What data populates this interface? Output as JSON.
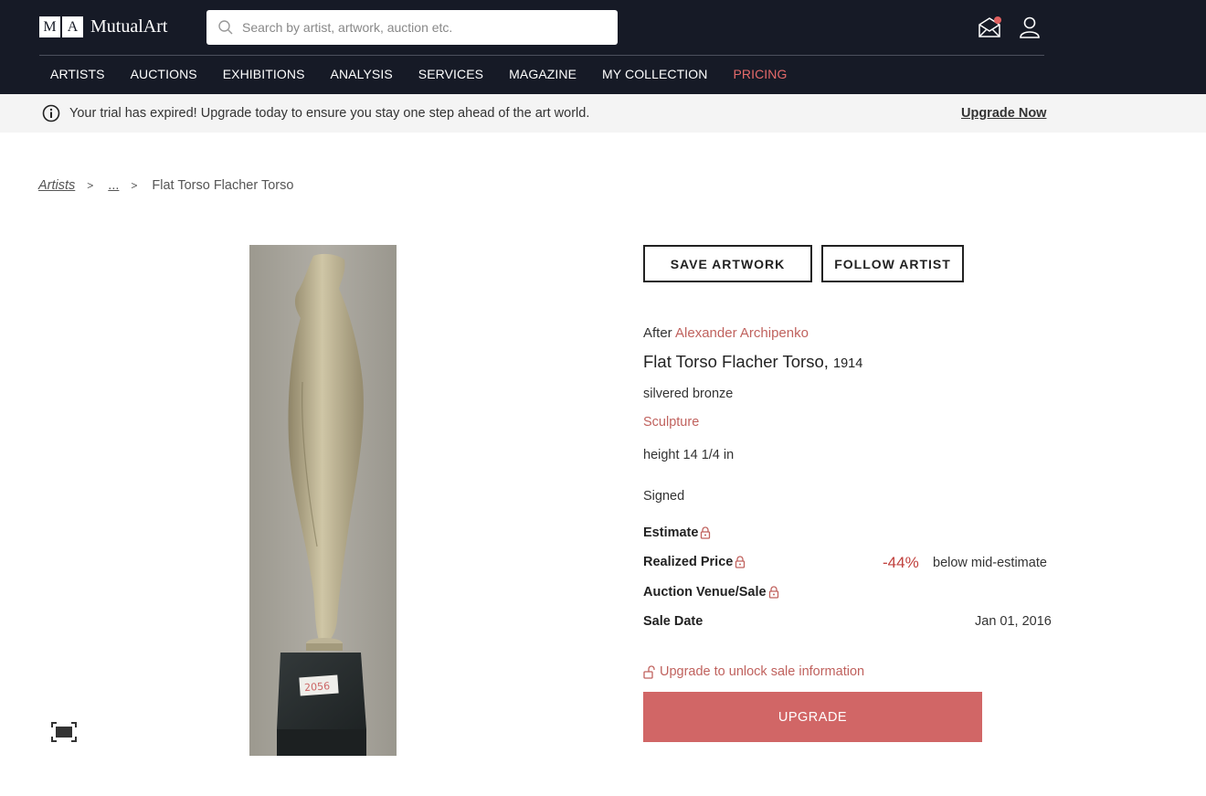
{
  "header": {
    "logo_letter_1": "M",
    "logo_letter_2": "A",
    "logo_text": "MutualArt",
    "search_placeholder": "Search by artist, artwork, auction etc.",
    "nav": [
      {
        "label": "ARTISTS"
      },
      {
        "label": "AUCTIONS"
      },
      {
        "label": "EXHIBITIONS"
      },
      {
        "label": "ANALYSIS"
      },
      {
        "label": "SERVICES"
      },
      {
        "label": "MAGAZINE"
      },
      {
        "label": "MY COLLECTION"
      },
      {
        "label": "PRICING"
      }
    ]
  },
  "trial_bar": {
    "message": "Your trial has expired! Upgrade today to ensure you stay one step ahead of the art world.",
    "upgrade_link": "Upgrade Now"
  },
  "breadcrumb": {
    "root": "Artists",
    "sep": ">",
    "ellipsis": "...",
    "current": "Flat Torso Flacher Torso"
  },
  "buttons": {
    "save": "SAVE ARTWORK",
    "follow": "FOLLOW ARTIST"
  },
  "artwork": {
    "after_prefix": "After",
    "artist": "Alexander Archipenko",
    "title": "Flat Torso Flacher Torso,",
    "year": "1914",
    "medium": "silvered bronze",
    "category": "Sculpture",
    "size": "height 14 1/4 in",
    "signed": "Signed",
    "label_tag": "2056"
  },
  "sale": {
    "estimate_label": "Estimate",
    "realized_label": "Realized Price",
    "realized_pct": "-44%",
    "realized_note": "below mid-estimate",
    "venue_label": "Auction Venue/Sale",
    "date_label": "Sale Date",
    "date_value": "Jan 01, 2016",
    "unlock_text": "Upgrade to unlock sale information",
    "upgrade_button": "UPGRADE"
  },
  "colors": {
    "header_bg": "#161a26",
    "accent": "#c0625e",
    "upgrade_button": "#d16666",
    "pricing": "#e46a6a"
  }
}
